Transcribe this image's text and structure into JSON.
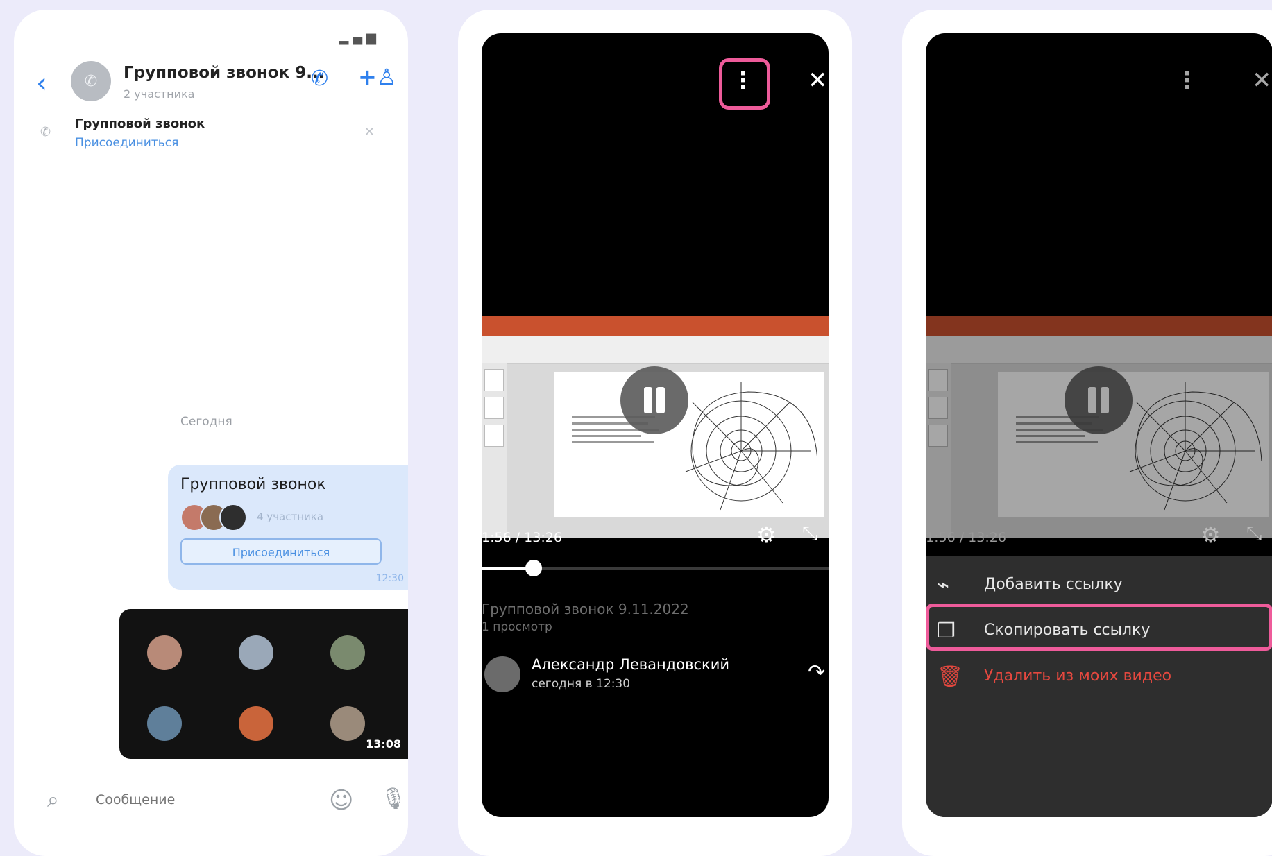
{
  "colors": {
    "background": "#ecebfa",
    "accent_blue": "#2f80ed",
    "highlight_pink": "#ee5b9a",
    "danger_red": "#e5483f"
  },
  "phone1": {
    "header": {
      "title": "Групповой звонок 9...",
      "subtitle": "2 участника"
    },
    "pinned": {
      "title": "Групповой звонок",
      "action": "Присоединиться"
    },
    "date_separator": "Сегодня",
    "call_bubble": {
      "title": "Групповой звонок",
      "participants_text": "4 участника",
      "join_button": "Присоединиться",
      "time": "12:30"
    },
    "video_thumb": {
      "duration": "13:08"
    },
    "composer": {
      "placeholder": "Сообщение"
    }
  },
  "phone2": {
    "time": "1:56 / 13:26",
    "progress": 0.15,
    "video_title": "Групповой звонок 9.11.2022",
    "views": "1 просмотр",
    "author_name": "Александр Левандовский",
    "author_time": "сегодня в 12:30"
  },
  "phone3": {
    "time": "1:56 / 13:26",
    "menu": [
      {
        "icon": "paperclip-icon",
        "label": "Добавить ссылку",
        "danger": false
      },
      {
        "icon": "copy-icon",
        "label": "Скопировать ссылку",
        "danger": false
      },
      {
        "icon": "trash-icon",
        "label": "Удалить из моих видео",
        "danger": true
      }
    ]
  }
}
